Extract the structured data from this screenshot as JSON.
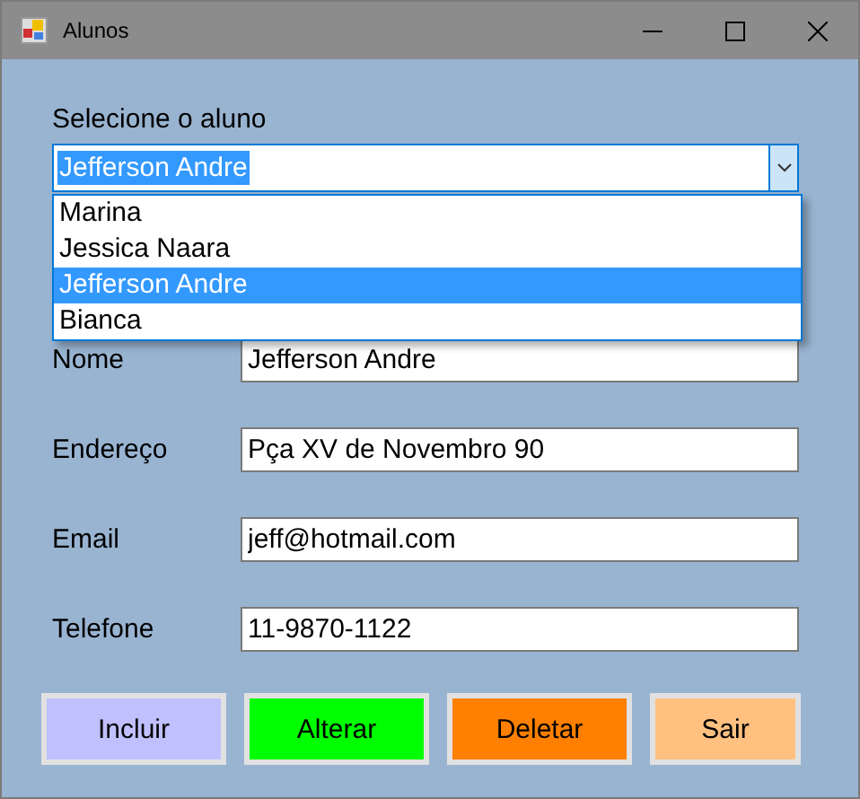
{
  "window": {
    "title": "Alunos"
  },
  "student_select": {
    "label": "Selecione o aluno",
    "value": "Jefferson Andre",
    "expanded": true,
    "options": [
      {
        "label": "Marina",
        "selected": false
      },
      {
        "label": "Jessica Naara",
        "selected": false
      },
      {
        "label": "Jefferson Andre",
        "selected": true
      },
      {
        "label": "Bianca",
        "selected": false
      }
    ]
  },
  "fields": [
    {
      "label": "Nome",
      "value": "Jefferson Andre"
    },
    {
      "label": "Endereço",
      "value": "Pça XV de Novembro 90"
    },
    {
      "label": "Email",
      "value": "jeff@hotmail.com"
    },
    {
      "label": "Telefone",
      "value": "11-9870-1122"
    }
  ],
  "buttons": [
    {
      "label": "Incluir",
      "color": "#c0c0ff"
    },
    {
      "label": "Alterar",
      "color": "#00ff00"
    },
    {
      "label": "Deletar",
      "color": "#ff8000"
    },
    {
      "label": "Sair",
      "color": "#ffc080"
    }
  ]
}
